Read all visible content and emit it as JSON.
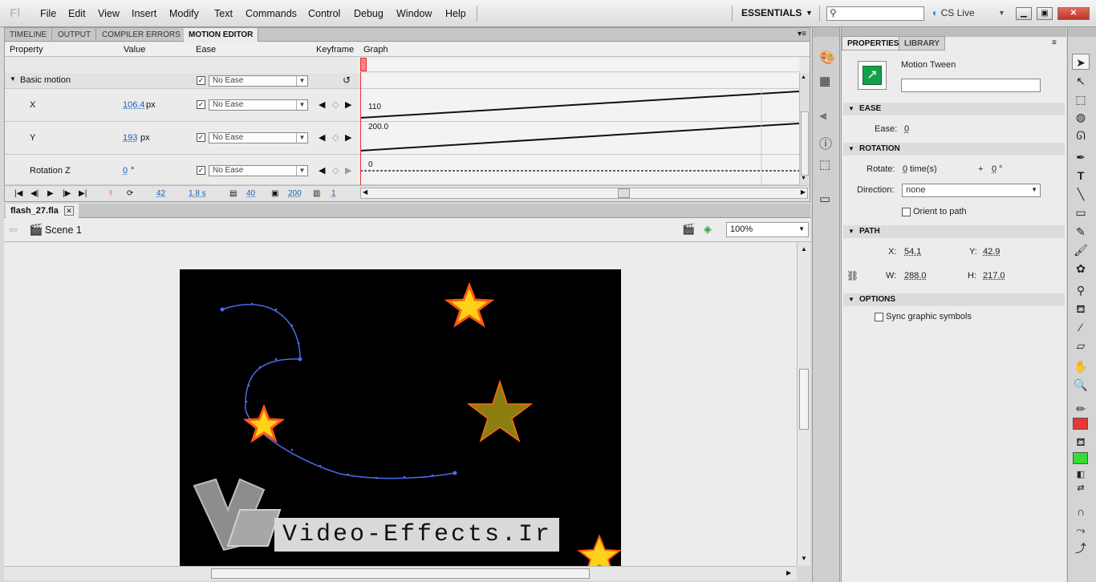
{
  "app": {
    "logo": "Fl"
  },
  "menu": [
    "File",
    "Edit",
    "View",
    "Insert",
    "Modify",
    "Text",
    "Commands",
    "Control",
    "Debug",
    "Window",
    "Help"
  ],
  "workspace": {
    "label": "ESSENTIALS",
    "cs_live": "CS Live"
  },
  "panel_tabs": [
    "TIMELINE",
    "OUTPUT",
    "COMPILER ERRORS",
    "MOTION EDITOR"
  ],
  "columns": {
    "property": "Property",
    "value": "Value",
    "ease": "Ease",
    "keyframe": "Keyframe",
    "graph": "Graph"
  },
  "group": {
    "label": "Basic motion",
    "ease": "No Ease"
  },
  "rows": [
    {
      "label": "X",
      "value": "106.4",
      "unit": "px",
      "ease": "No Ease",
      "graph_label": "110"
    },
    {
      "label": "Y",
      "value": "193",
      "unit": "px",
      "ease": "No Ease",
      "graph_label": "200.0"
    },
    {
      "label": "Rotation Z",
      "value": "0",
      "unit": "°",
      "ease": "No Ease",
      "graph_label": "0"
    }
  ],
  "me_toolbar": {
    "frame": "42",
    "time": "1.8 s",
    "graph_size": "40",
    "expanded_size": "200",
    "viewable_frames": "1"
  },
  "document": {
    "tab": "flash_27.fla",
    "scene": "Scene 1",
    "zoom": "100%"
  },
  "stage_text": "Video-Effects.Ir",
  "properties": {
    "tabs": [
      "PROPERTIES",
      "LIBRARY"
    ],
    "type": "Motion Tween",
    "ease_section": "EASE",
    "ease_label": "Ease:",
    "ease_value": "0",
    "rotation_section": "ROTATION",
    "rotate_label": "Rotate:",
    "rotate_times": "0",
    "times_unit": "time(s)",
    "plus": "+",
    "rotate_degrees": "0",
    "degree_unit": "°",
    "direction_label": "Direction:",
    "direction_value": "none",
    "orient_label": "Orient to path",
    "path_section": "PATH",
    "x_label": "X:",
    "x_value": "54.1",
    "y_label": "Y:",
    "y_value": "42.9",
    "w_label": "W:",
    "w_value": "288.0",
    "h_label": "H:",
    "h_value": "217.0",
    "options_section": "OPTIONS",
    "sync_label": "Sync graphic symbols"
  },
  "colors": {
    "stroke": "#e53935",
    "fill": "#33dd33",
    "path": "#4a6cf0"
  }
}
